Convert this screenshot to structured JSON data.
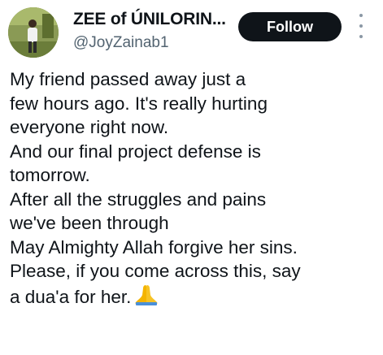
{
  "author": {
    "display_name": "ZEE of ÚNILORIN...",
    "handle": "@JoyZainab1"
  },
  "actions": {
    "follow_label": "Follow"
  },
  "tweet": {
    "lines": [
      "My friend passed away just a",
      "few hours ago. It's really hurting",
      "everyone right now.",
      "And our final project defense is",
      "tomorrow.",
      "After all the struggles and pains",
      "we've been through",
      "May Almighty Allah forgive her sins.",
      "Please, if you come across this, say",
      "a dua'a for her."
    ],
    "emoji": "folded-hands-icon"
  },
  "colors": {
    "text": "#0f1419",
    "secondary_text": "#536471",
    "follow_button_bg": "#0f1419",
    "follow_button_text": "#ffffff",
    "emoji": "#f4b400"
  }
}
